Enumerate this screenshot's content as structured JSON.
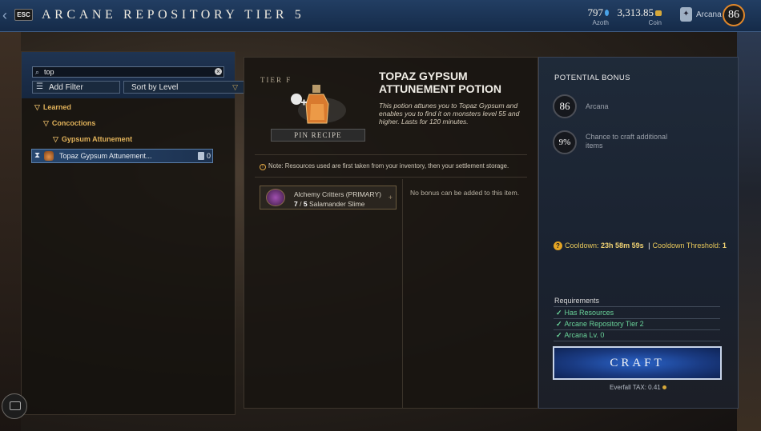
{
  "header": {
    "esc_label": "ESC",
    "title": "ARCANE REPOSITORY TIER 5",
    "azoth_value": "797",
    "azoth_label": "Azoth",
    "coin_value": "3,313.85",
    "coin_label": "Coin",
    "arcana_label": "Arcana",
    "arcana_level": "86"
  },
  "left": {
    "search_value": "top",
    "add_filter_label": "Add Filter",
    "sort_label": "Sort by Level",
    "tree": {
      "learned": "Learned",
      "concoctions": "Concoctions",
      "gypsum": "Gypsum Attunement"
    },
    "recipe": {
      "name": "Topaz Gypsum Attunement...",
      "count": "0"
    }
  },
  "center": {
    "tier_label": "TIER F",
    "pin_recipe": "PIN RECIPE",
    "title": "TOPAZ GYPSUM ATTUNEMENT POTION",
    "description": "This potion attunes you to Topaz Gypsum and enables you to find it on monsters level 55 and higher. Lasts for 120 minutes.",
    "note": "Note: Resources used are first taken from your inventory, then your settlement storage.",
    "ingredient": {
      "name": "Alchemy Critters (PRIMARY)",
      "have": "7",
      "need": "5",
      "item": "Salamander Slime"
    },
    "no_bonus": "No bonus can be added to this item."
  },
  "right": {
    "potential_bonus_title": "POTENTIAL BONUS",
    "arcana_value": "86",
    "arcana_label": "Arcana",
    "chance_value": "9%",
    "chance_label": "Chance to craft additional items",
    "cooldown_label": "Cooldown:",
    "cooldown_value": "23h 58m 59s",
    "cooldown_sep": "|",
    "threshold_label": "Cooldown Threshold:",
    "threshold_value": "1",
    "requirements_title": "Requirements",
    "req_1": "Has Resources",
    "req_2": "Arcane Repository Tier 2",
    "req_3": "Arcana Lv. 0",
    "craft_label": "CRAFT",
    "tax_label": "Everfall TAX: 0.41"
  },
  "colors": {
    "header_blue": "#1b3558",
    "accent_gold": "#e1b25a",
    "requirement_green": "#6ad49a",
    "craft_blue": "#1a3b83",
    "level_ring": "#e2882a"
  },
  "icons": [
    "back-icon",
    "search-icon",
    "clear-icon",
    "filter-icon",
    "sort-icon",
    "hourglass-icon",
    "book-icon",
    "info-icon",
    "cooldown-icon",
    "check-icon",
    "chat-icon"
  ]
}
